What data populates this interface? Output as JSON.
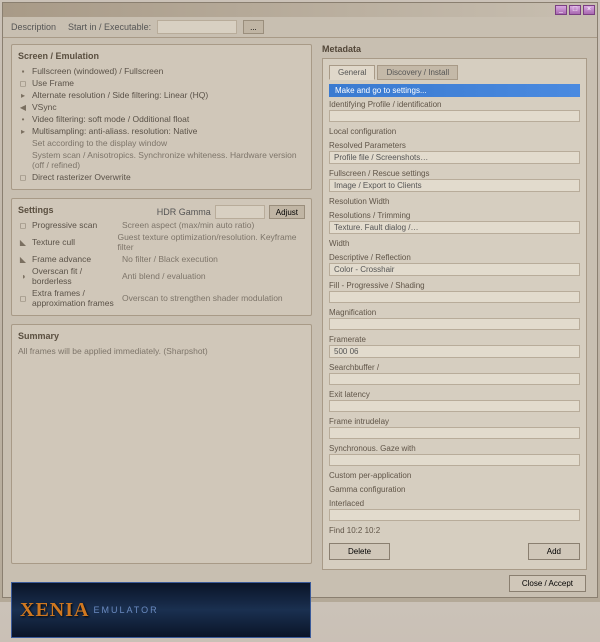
{
  "titlebar": {
    "min": "_",
    "max": "□",
    "close": "×"
  },
  "toolbar": {
    "description_label": "Description",
    "path_label": "Start in / Executable:",
    "path_value": "",
    "more": "..."
  },
  "left": {
    "panel1": {
      "title": "Screen / Emulation",
      "items": [
        {
          "icon": "▪",
          "text": "Fullscreen (windowed) / Fullscreen"
        },
        {
          "icon": "◻",
          "text": "Use Frame"
        },
        {
          "icon": "▸",
          "text": "Alternate resolution / Side filtering: Linear (HQ)"
        },
        {
          "icon": "◀",
          "text": "VSync"
        },
        {
          "icon": "•",
          "text": "Video filtering: soft mode / Odditional float"
        },
        {
          "icon": "▸",
          "text": "Multisampling: anti-aliass. resolution: Native"
        },
        {
          "icon": "",
          "text": "Set according to the display window"
        },
        {
          "icon": "",
          "text": "System scan / Anisotropics. Synchronize whiteness. Hardware version (off / refined)"
        },
        {
          "icon": "◻",
          "text": "Direct rasterizer    Overwrite"
        }
      ]
    },
    "panel2": {
      "title": "Settings",
      "hdr_label": "HDR Gamma",
      "hdr_btn": "Adjust",
      "items": [
        {
          "icon": "◻",
          "text": "Progressive scan",
          "right": "Screen aspect (max/min auto ratio)"
        },
        {
          "icon": "◣",
          "text": "Texture cull",
          "right": "Guest texture optimization/resolution. Keyframe filter"
        },
        {
          "icon": "◣",
          "text": "Frame advance",
          "right": "No filter / Black execution"
        },
        {
          "icon": "◑",
          "text": "Overscan fit / borderless",
          "right": "Anti blend / evaluation"
        },
        {
          "icon": "◻",
          "text": "Extra frames / approximation frames",
          "right": "Overscan to strengthen shader modulation"
        }
      ]
    },
    "panel3": {
      "title": "Summary",
      "text": "All frames will be applied immediately. (Sharpshot)"
    }
  },
  "right": {
    "title": "Metadata",
    "tabs": [
      "General",
      "Discovery / Install"
    ],
    "highlight": "Make and go to settings...",
    "sections": [
      {
        "label": "Identifying Profile / identification",
        "value": ""
      },
      {
        "label": "Local configuration",
        "value": ""
      },
      {
        "label": "Resolved Parameters",
        "value": "Profile file / Screenshots…"
      },
      {
        "label": "Fullscreen / Rescue settings",
        "value": "Image / Export to Clients"
      },
      {
        "label": "Resolution Width",
        "value": ""
      },
      {
        "label": "Resolutions / Trimming",
        "value": "Texture. Fault dialog /…"
      },
      {
        "label": "Width",
        "value": ""
      },
      {
        "label": "Descriptive / Reflection",
        "value": "Color - Crosshair"
      },
      {
        "label": "Fill - Progressive / Shading",
        "value": ""
      },
      {
        "label": "Magnification",
        "value": ""
      },
      {
        "label": "Framerate",
        "value": "500        06"
      },
      {
        "label": "Searchbuffer /",
        "value": ""
      },
      {
        "label": "Exit latency",
        "value": ""
      },
      {
        "label": "Frame intrudelay",
        "value": ""
      },
      {
        "label": "Synchronous. Gaze with",
        "value": ""
      },
      {
        "label": "Custom per-application",
        "value": ""
      },
      {
        "label": "Gamma configuration",
        "value": ""
      },
      {
        "label": "Interlaced",
        "value": ""
      },
      {
        "label": "Find        10:2    10:2"
      }
    ],
    "btn_delete": "Delete",
    "btn_add": "Add"
  },
  "brand": {
    "name": "XENIA",
    "sub": "EMULATOR"
  },
  "bottom": {
    "close": "Close / Accept"
  }
}
